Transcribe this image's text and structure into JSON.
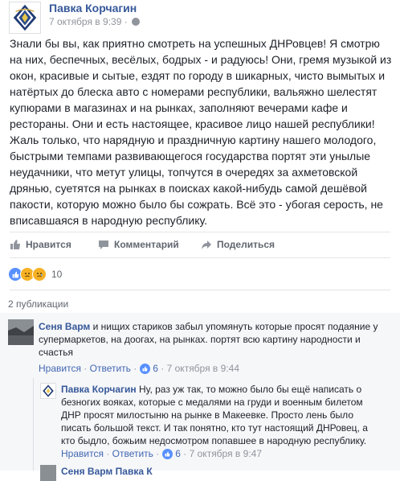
{
  "post": {
    "author": "Павка Корчагин",
    "timestamp": "7 октября в 9:39 ·",
    "text": "Знали бы вы, как приятно смотреть на успешных ДНРовцев! Я смотрю на них, беспечных, весёлых, бодрых - и радуюсь! Они, гремя музыкой из окон, красивые и сытые, ездят по городу в шикарных, чисто вымытых и натёртых до блеска авто с номерами республики, вальяжно шелестят купюрами в магазинах и на рынках, заполняют вечерами кафе и рестораны. Они и есть настоящее, красивое лицо нашей республики! Жаль только, что нарядную и праздничную картину нашего молодого, быстрыми темпами развивающегося государства портят эти унылые неудачники, что метут улицы, топчутся в очередях за ахметовской дрянью, суетятся на рынках в поисках какой-нибудь самой дешёвой пакости, которую можно было бы сожрать. Всё это - убогая серость, не вписавшаяся в народную республику."
  },
  "actions": {
    "like": "Нравится",
    "comment": "Комментарий",
    "share": "Поделиться"
  },
  "reactions": {
    "count": "10",
    "types": [
      "like-icon",
      "sad-icon",
      "sad-icon"
    ],
    "colors": {
      "like": "#5890ff",
      "sad": "#f7b125"
    }
  },
  "shares": {
    "label": "2 публикации"
  },
  "comments": [
    {
      "author": "Сеня Варм",
      "text": " и нищих стариков забыл упомянуть которые просят подаяние у супермаркетов, на доогах, на рынках. портят всю картину народности и счастья",
      "like": "Нравится",
      "reply": "Ответить",
      "likes": "6",
      "time": "7 октября в 9:44"
    },
    {
      "author": "Павка Корчагин",
      "text": " Ну, раз уж так, то можно было бы ещё написать о безногих вояках, которые с медалями на груди и военным билетом ДНР просят милостыню на рынке в Макеевке. Просто лень было писать большой текст. И так понятно, кто тут настоящий ДНРовец, а кто быдло, божьим недосмотром попавшее в народную республику.",
      "like": "Нравится",
      "reply": "Ответить",
      "likes": "6",
      "time": "7 октября в 9:47"
    }
  ],
  "partial_comment": {
    "meta": "Сеня Варм  Павка К"
  }
}
